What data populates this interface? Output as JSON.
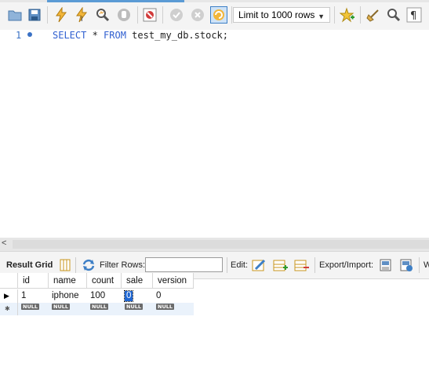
{
  "toolbar": {
    "limit_label": "Limit to 1000 rows",
    "buttons": [
      "open-folder-icon",
      "save-icon",
      "execute-icon",
      "execute-current-icon",
      "explain-icon",
      "stop-icon",
      "toggle-error-icon",
      "commit-icon",
      "rollback-icon",
      "autocommit-icon",
      "bookmark-add-icon",
      "beautify-icon",
      "find-icon",
      "invisible-chars-icon"
    ]
  },
  "editor": {
    "line_number": "1",
    "code": {
      "kw1": "SELECT",
      "sym": " * ",
      "kw2": "FROM",
      "rest": " test_my_db.stock;"
    }
  },
  "scrollbar": {
    "left_arrow": "<"
  },
  "result_toolbar": {
    "result_grid": "Result Grid",
    "filter_rows": "Filter Rows:",
    "filter_value": "",
    "edit": "Edit:",
    "export_import": "Export/Import:",
    "truncated": "W"
  },
  "grid": {
    "columns": [
      "id",
      "name",
      "count",
      "sale",
      "version"
    ],
    "rows": [
      [
        "1",
        "iphone",
        "100",
        "0",
        "0"
      ],
      [
        "NULL",
        "NULL",
        "NULL",
        "NULL",
        "NULL"
      ]
    ],
    "row_markers": [
      "▶",
      "✱"
    ]
  },
  "colors": {
    "keyword": "#2f5fd0",
    "line_number": "#3a71c5",
    "selection": "#1f66d1",
    "null_badge": "#6b6b6b"
  }
}
